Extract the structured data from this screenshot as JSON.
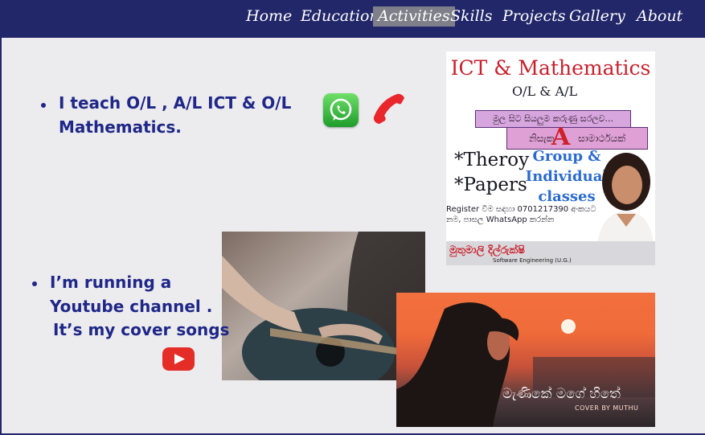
{
  "nav": {
    "items": [
      {
        "label": "Home"
      },
      {
        "label": "Education"
      },
      {
        "label": "Activities",
        "active": true
      },
      {
        "label": "Skills"
      },
      {
        "label": "Projects"
      },
      {
        "label": "Gallery"
      },
      {
        "label": "About"
      }
    ]
  },
  "content": {
    "bullet1": {
      "line1": "I teach O/L , A/L ICT  & O/L",
      "line2": "Mathematics."
    },
    "bullet2": {
      "line1": "I’m running a",
      "line2": "Youtube channel .",
      "line3": "It’s my cover songs"
    }
  },
  "poster": {
    "title": "ICT & Mathematics",
    "levels": "O/L & A/L",
    "banner1": "මුල සිට සියලුම කරුණු සරලව...",
    "banner2_left": "නිසැක",
    "banner2_letter": "A",
    "banner2_right": "සාමාර්ථයක්",
    "item1": "*Theroy",
    "item2": "*Papers",
    "group_line1": "Group &",
    "group_line2": "Individual",
    "group_line3": "classes",
    "register_line1": "Register වීම සඳහා 0701217390 අංකයට",
    "register_line2": "නම, පාසල WhatsApp කරන්න",
    "teacher_name": "මුතුමාලි දිල්රුක්ෂි",
    "teacher_title": "Software Engineering (U.G.)"
  },
  "video": {
    "caption": "මැණිකේ මගේ හිතේ",
    "cover": "COVER BY MUTHU"
  },
  "icons": [
    "whatsapp-icon",
    "phone-icon",
    "youtube-icon"
  ],
  "colors": {
    "nav_bg": "#22276a",
    "text": "#1f2788",
    "active_tab": "#7f7f89",
    "page_bg": "#ecebee"
  }
}
